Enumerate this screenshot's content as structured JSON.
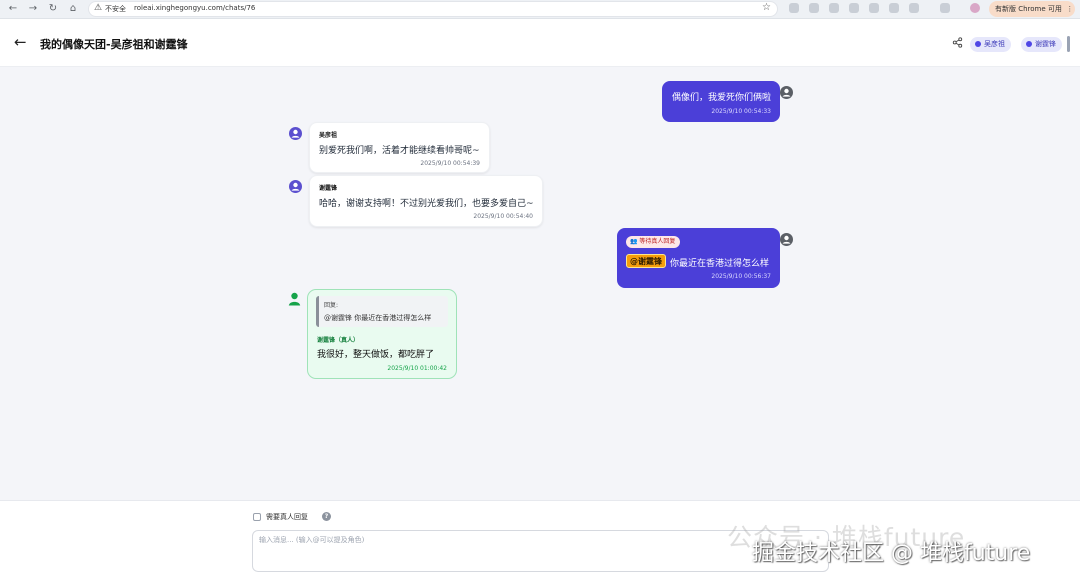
{
  "browser": {
    "insecure_label": "不安全",
    "url": "roleai.xinghegongyu.com/chats/76",
    "update_label": "有新版 Chrome 可用"
  },
  "header": {
    "title": "我的偶像天团-吴彦祖和谢霆锋",
    "members": [
      "吴彦祖",
      "谢霆锋"
    ]
  },
  "messages": [
    {
      "role": "user",
      "text": "偶像们，我爱死你们俩啦",
      "time": "2025/9/10 00:54:33"
    },
    {
      "role": "ai",
      "sender": "吴彦祖",
      "text": "别爱死我们啊，活着才能继续看帅哥呢~",
      "time": "2025/9/10 00:54:39"
    },
    {
      "role": "ai",
      "sender": "谢霆锋",
      "text": "哈哈，谢谢支持啊！不过别光爱我们，也要多爱自己~",
      "time": "2025/9/10 00:54:40"
    },
    {
      "role": "user",
      "badge": "等待真人回复",
      "mention": "@谢霆锋",
      "text": "你最近在香港过得怎么样",
      "time": "2025/9/10 00:56:37"
    },
    {
      "role": "human",
      "quote_label": "回复:",
      "quote_text": "@谢霆锋 你最近在香港过得怎么样",
      "sender": "谢霆锋（真人）",
      "text": "我很好，整天做饭，都吃胖了",
      "time": "2025/9/10 01:00:42"
    }
  ],
  "composer": {
    "checkbox_label": "需要真人回复",
    "placeholder": "输入消息... (输入@可以提及角色)"
  },
  "watermark": {
    "line1": "公众号 · 堆栈future",
    "line2": "掘金技术社区 @ 堆栈future"
  },
  "colors": {
    "user_bubble": "#4b3fd8",
    "human_bubble": "#e9fbf0",
    "accent": "#4f46e5",
    "human_accent": "#16a34a"
  }
}
